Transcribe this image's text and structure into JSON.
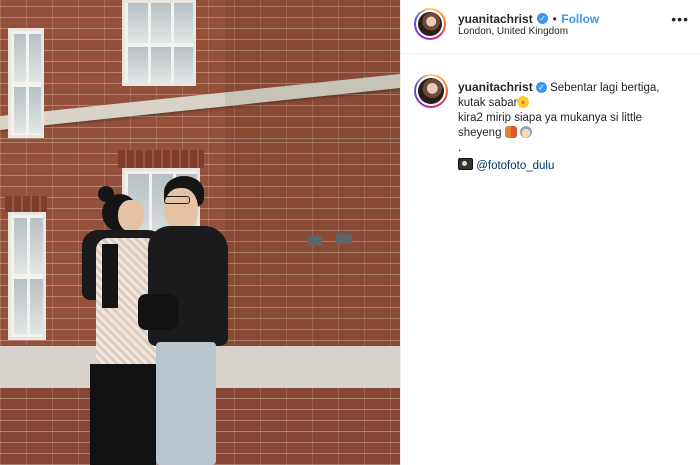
{
  "post": {
    "username": "yuanitachrist",
    "location": "London, United Kingdom",
    "follow_label": "Follow",
    "separator": "•",
    "more_icon": "•••",
    "verified_icon": "✓",
    "caption": {
      "line1": "Sebentar lagi bertiga,",
      "line2": "kutak sabar",
      "line3": "kira2 mirip siapa ya mukanya si little",
      "line4": "sheyeng",
      "line5": ".",
      "mention": "@fotofoto_dulu"
    }
  },
  "icons": {
    "verified": "verified-badge-icon",
    "more": "more-options-icon",
    "emoji_1": "star-struck-emoji-icon",
    "emoji_2": "kids-emoji-icon",
    "emoji_3": "baby-emoji-icon",
    "camera": "camera-emoji-icon"
  },
  "colors": {
    "link": "#3897f0",
    "mention": "#003569",
    "brick": "#93503a"
  }
}
